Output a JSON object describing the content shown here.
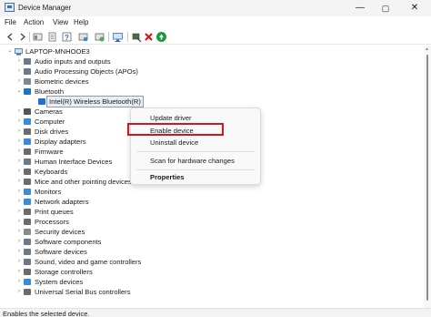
{
  "window": {
    "title": "Device Manager",
    "controls": {
      "minimize": "—",
      "maximize": "▢",
      "close": "✕"
    }
  },
  "menubar": [
    "File",
    "Action",
    "View",
    "Help"
  ],
  "toolbar": {
    "icons": [
      "back-arrow-icon",
      "forward-arrow-icon",
      "tree-view-icon",
      "properties-icon",
      "help-icon",
      "update-driver-icon",
      "scan-hardware-icon",
      "monitor-icon",
      "disable-device-icon",
      "uninstall-x-icon",
      "enable-device-icon"
    ]
  },
  "tree": {
    "root": "LAPTOP-MNHOOE3",
    "items": [
      {
        "label": "Audio inputs and outputs",
        "icon": "speaker-icon",
        "color": "#6b7a8a"
      },
      {
        "label": "Audio Processing Objects (APOs)",
        "icon": "speaker-icon",
        "color": "#6b7a8a"
      },
      {
        "label": "Biometric devices",
        "icon": "fingerprint-icon",
        "color": "#7a8794"
      },
      {
        "label": "Bluetooth",
        "icon": "bluetooth-icon",
        "color": "#1f6fd1",
        "expanded": true
      },
      {
        "label": "Intel(R) Wireless Bluetooth(R)",
        "icon": "bluetooth-icon",
        "color": "#1f6fd1",
        "child": true,
        "selected": true
      },
      {
        "label": "Cameras",
        "icon": "camera-icon",
        "color": "#555555"
      },
      {
        "label": "Computer",
        "icon": "computer-icon",
        "color": "#3a8ad6"
      },
      {
        "label": "Disk drives",
        "icon": "disk-icon",
        "color": "#6b6b6b"
      },
      {
        "label": "Display adapters",
        "icon": "display-icon",
        "color": "#3a8ad6"
      },
      {
        "label": "Firmware",
        "icon": "firmware-icon",
        "color": "#6b6b6b"
      },
      {
        "label": "Human Interface Devices",
        "icon": "hid-icon",
        "color": "#6b7a8a"
      },
      {
        "label": "Keyboards",
        "icon": "keyboard-icon",
        "color": "#6b6b6b"
      },
      {
        "label": "Mice and other pointing devices",
        "icon": "mouse-icon",
        "color": "#6b6b6b"
      },
      {
        "label": "Monitors",
        "icon": "monitor-icon",
        "color": "#3a8ad6"
      },
      {
        "label": "Network adapters",
        "icon": "network-icon",
        "color": "#3a8ad6"
      },
      {
        "label": "Print queues",
        "icon": "printer-icon",
        "color": "#6b6b6b"
      },
      {
        "label": "Processors",
        "icon": "processor-icon",
        "color": "#6b6b6b"
      },
      {
        "label": "Security devices",
        "icon": "security-icon",
        "color": "#8a8a8a"
      },
      {
        "label": "Software components",
        "icon": "software-icon",
        "color": "#6b7a8a"
      },
      {
        "label": "Software devices",
        "icon": "software-icon",
        "color": "#6b7a8a"
      },
      {
        "label": "Sound, video and game controllers",
        "icon": "speaker-icon",
        "color": "#6b7a8a"
      },
      {
        "label": "Storage controllers",
        "icon": "storage-icon",
        "color": "#6b6b6b"
      },
      {
        "label": "System devices",
        "icon": "system-icon",
        "color": "#3a8ad6"
      },
      {
        "label": "Universal Serial Bus controllers",
        "icon": "usb-icon",
        "color": "#6b6b6b"
      }
    ]
  },
  "context_menu": {
    "items": [
      "Update driver",
      "Enable device",
      "Uninstall device",
      "Scan for hardware changes",
      "Properties"
    ],
    "highlighted": "Enable device",
    "highlight_color": "#d4151b"
  },
  "statusbar": {
    "text": "Enables the selected device."
  }
}
